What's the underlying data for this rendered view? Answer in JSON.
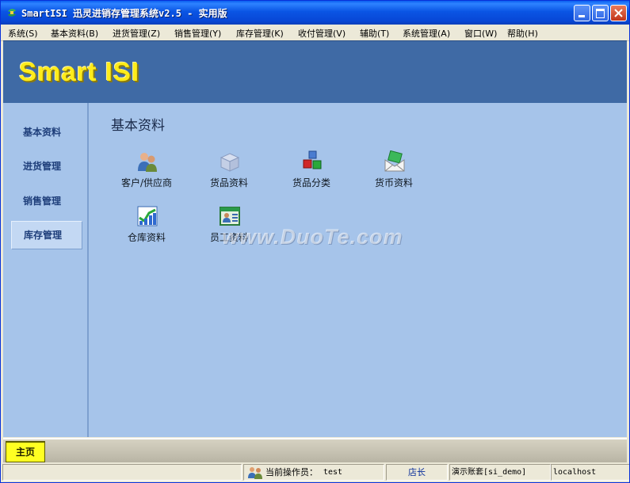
{
  "window": {
    "title": "SmartISI 迅灵进销存管理系统v2.5 - 实用版",
    "controls": {
      "minimize": "minimize",
      "maximize": "maximize",
      "close": "close"
    }
  },
  "menu": [
    "系统(S)",
    "基本资料(B)",
    "进货管理(Z)",
    "销售管理(Y)",
    "库存管理(K)",
    "收付管理(V)",
    "辅助(T)",
    "系统管理(A)",
    "窗口(W)",
    "帮助(H)"
  ],
  "banner": {
    "logo": "Smart ISI"
  },
  "sidebar": {
    "items": [
      {
        "label": "基本资料"
      },
      {
        "label": "进货管理"
      },
      {
        "label": "销售管理"
      },
      {
        "label": "库存管理",
        "active": true
      }
    ]
  },
  "main": {
    "section_title": "基本资料",
    "tiles": [
      {
        "label": "客户/供应商",
        "icon": "people-icon"
      },
      {
        "label": "货品资料",
        "icon": "box-icon"
      },
      {
        "label": "货品分类",
        "icon": "cubes-icon"
      },
      {
        "label": "货币资料",
        "icon": "money-envelope-icon"
      },
      {
        "label": "仓库资料",
        "icon": "chart-icon"
      },
      {
        "label": "员工资料",
        "icon": "id-card-icon"
      }
    ],
    "watermark": "www.DuoTe.com"
  },
  "tabs": {
    "main": "主页"
  },
  "status": {
    "operator_label": "当前操作员：",
    "operator": "test",
    "role": "店长",
    "account": "演示账套[si_demo]",
    "host": "localhost"
  },
  "colors": {
    "titlebar": "#0a55e4",
    "banner": "#3f6aa5",
    "panel": "#a6c4ea",
    "logo": "#ffec1a",
    "active_tab": "#ffff22"
  }
}
